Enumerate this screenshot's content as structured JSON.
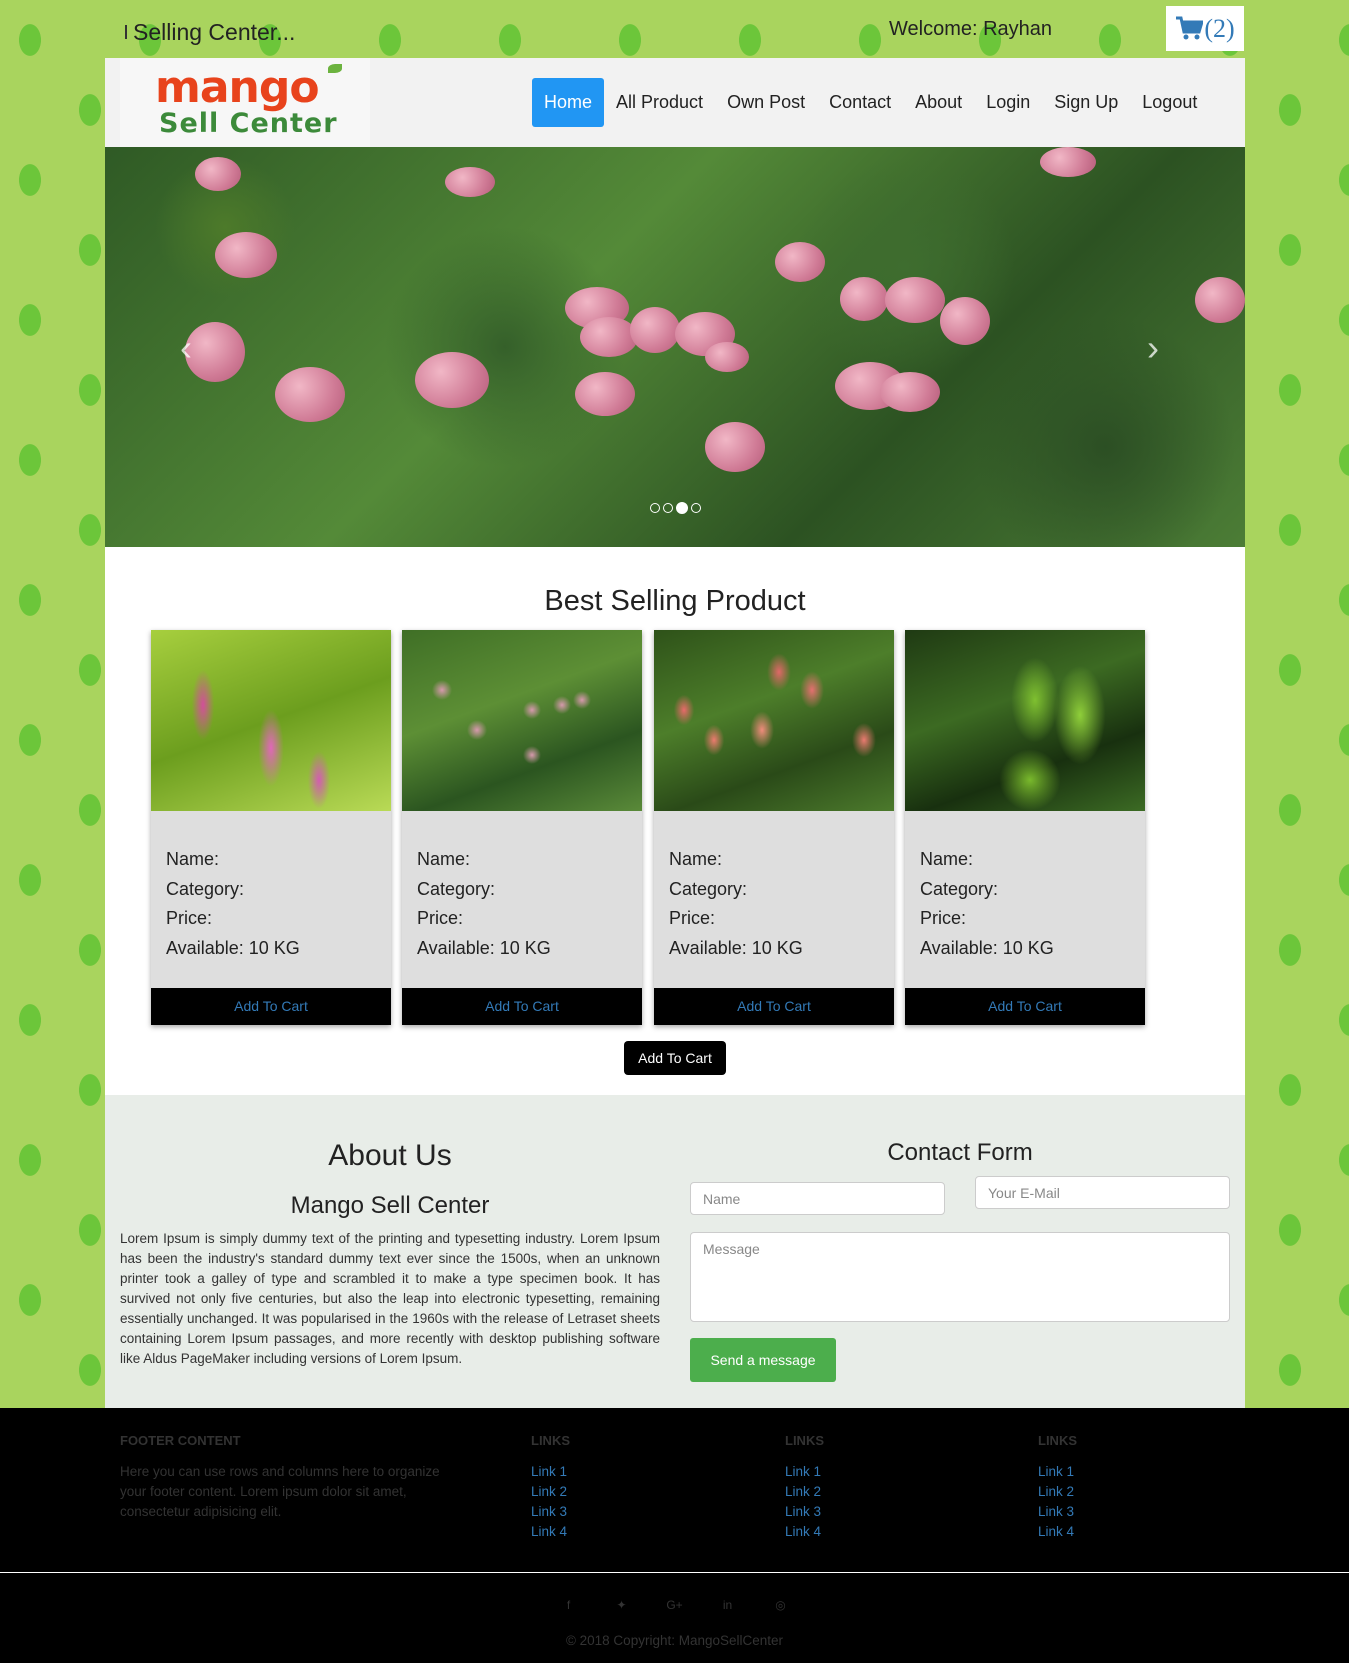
{
  "topbar": {
    "brand": "Selling Center...",
    "welcome": "Welcome: Rayhan",
    "cart_count": "(2)"
  },
  "logo": {
    "line1": "mango",
    "line2": "Sell Center"
  },
  "nav": [
    "Home",
    "All Product",
    "Own Post",
    "Contact",
    "About",
    "Login",
    "Sign Up",
    "Logout"
  ],
  "carousel": {
    "slides": 4,
    "active": 2
  },
  "products": {
    "heading": "Best Selling Product",
    "cards": [
      {
        "name": "Name:",
        "category": "Category:",
        "price": "Price:",
        "available": "Available: 10 KG",
        "button": "Add To Cart"
      },
      {
        "name": "Name:",
        "category": "Category:",
        "price": "Price:",
        "available": "Available: 10 KG",
        "button": "Add To Cart"
      },
      {
        "name": "Name:",
        "category": "Category:",
        "price": "Price:",
        "available": "Available: 10 KG",
        "button": "Add To Cart"
      },
      {
        "name": "Name:",
        "category": "Category:",
        "price": "Price:",
        "available": "Available: 10 KG",
        "button": "Add To Cart"
      }
    ],
    "main_button": "Add To Cart"
  },
  "about": {
    "title": "About Us",
    "subtitle": "Mango Sell Center",
    "text": "Lorem Ipsum is simply dummy text of the printing and typesetting industry. Lorem Ipsum has been the industry's standard dummy text ever since the 1500s, when an unknown printer took a galley of type and scrambled it to make a type specimen book. It has survived not only five centuries, but also the leap into electronic typesetting, remaining essentially unchanged. It was popularised in the 1960s with the release of Letraset sheets containing Lorem Ipsum passages, and more recently with desktop publishing software like Aldus PageMaker including versions of Lorem Ipsum."
  },
  "contact": {
    "title": "Contact Form",
    "name_placeholder": "Name",
    "email_placeholder": "Your E-Mail",
    "message_placeholder": "Message",
    "send": "Send a message"
  },
  "footer": {
    "content_title": "Footer Content",
    "content_text": "Here you can use rows and columns here to organize your footer content. Lorem ipsum dolor sit amet, consectetur adipisicing elit.",
    "link_cols": [
      {
        "title": "Links",
        "links": [
          "Link 1",
          "Link 2",
          "Link 3",
          "Link 4"
        ]
      },
      {
        "title": "Links",
        "links": [
          "Link 1",
          "Link 2",
          "Link 3",
          "Link 4"
        ]
      },
      {
        "title": "Links",
        "links": [
          "Link 1",
          "Link 2",
          "Link 3",
          "Link 4"
        ]
      }
    ],
    "social": [
      "facebook-icon",
      "twitter-icon",
      "google-plus-icon",
      "linkedin-icon",
      "dribbble-icon"
    ],
    "copyright": "© 2018 Copyright: MangoSellCenter"
  },
  "colors": {
    "nav_active": "#2196f3",
    "link": "#337ab7",
    "send": "#4cae4c",
    "bg_green": "#a9d45e"
  }
}
